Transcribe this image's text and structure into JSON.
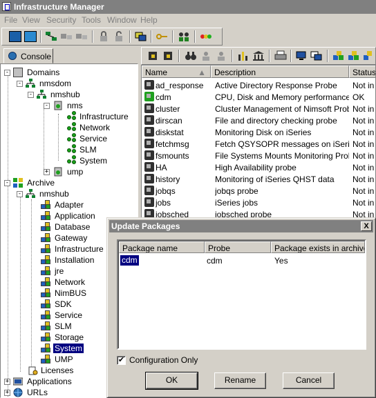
{
  "window": {
    "title": "Infrastructure Manager"
  },
  "menu": [
    "File",
    "View",
    "Security",
    "Tools",
    "Window",
    "Help"
  ],
  "left_tab": {
    "label": "Console"
  },
  "tree": {
    "domains": "Domains",
    "nmsdom": "nmsdom",
    "nmshub": "nmshub",
    "nms": "nms",
    "nms_children": [
      "Infrastructure",
      "Network",
      "Service",
      "SLM",
      "System"
    ],
    "ump": "ump",
    "archive": "Archive",
    "archive_hub": "nmshub",
    "archive_children": [
      "Adapter",
      "Application",
      "Database",
      "Gateway",
      "Infrastructure",
      "Installation",
      "jre",
      "Network",
      "NimBUS",
      "SDK",
      "Service",
      "SLM",
      "Storage",
      "System",
      "UMP"
    ],
    "selected": "System",
    "licenses": "Licenses",
    "applications": "Applications",
    "urls": "URLs"
  },
  "list": {
    "columns": [
      "Name",
      "Description",
      "Status"
    ],
    "rows": [
      [
        "ad_response",
        "Active Directory Response Probe",
        "Not in a"
      ],
      [
        "cdm",
        "CPU, Disk and Memory performance ...",
        "OK"
      ],
      [
        "cluster",
        "Cluster Management of Nimsoft Probes",
        "Not in a"
      ],
      [
        "dirscan",
        "File and directory checking probe",
        "Not in a"
      ],
      [
        "diskstat",
        "Monitoring Disk on iSeries",
        "Not in a"
      ],
      [
        "fetchmsg",
        "Fetch QSYSOPR messages on iSeries",
        "Not in a"
      ],
      [
        "fsmounts",
        "File Systems Mounts Monitoring Probe",
        "Not in a"
      ],
      [
        "HA",
        "High Availability probe",
        "Not in a"
      ],
      [
        "history",
        "Monitoring of iSeries QHST data",
        "Not in a"
      ],
      [
        "jobqs",
        "jobqs probe",
        "Not in a"
      ],
      [
        "jobs",
        "iSeries jobs",
        "Not in a"
      ],
      [
        "jobsched",
        "jobsched probe",
        "Not in a"
      ]
    ]
  },
  "dialog": {
    "title": "Update Packages",
    "close": "X",
    "columns": [
      "Package name",
      "Probe",
      "Package exists in archive"
    ],
    "rows": [
      [
        "cdm",
        "cdm",
        "Yes"
      ]
    ],
    "checkbox_label": "Configuration Only",
    "checkbox_mark": "✔",
    "ok": "OK",
    "rename": "Rename",
    "cancel": "Cancel"
  }
}
